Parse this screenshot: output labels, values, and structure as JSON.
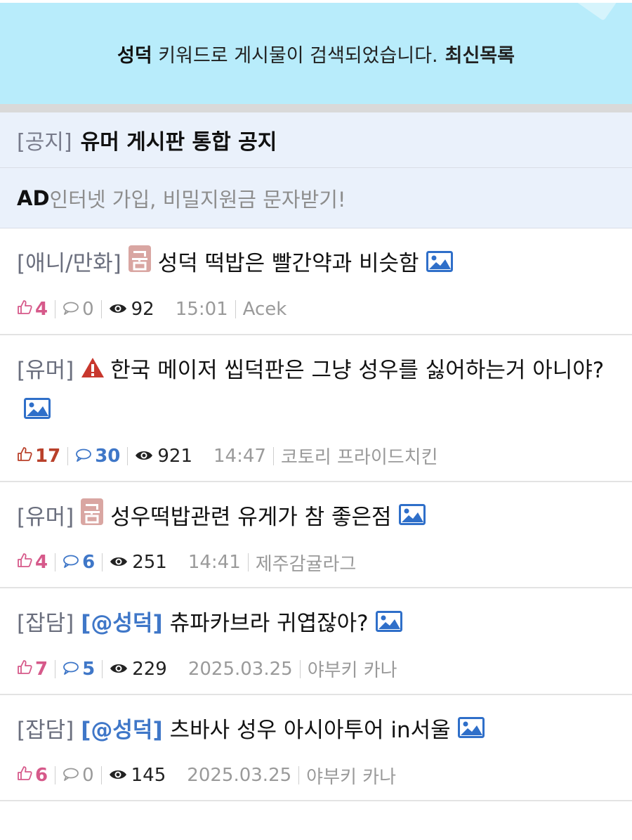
{
  "banner": {
    "keyword": "성덕",
    "message": " 키워드로 게시물이 검색되었습니다.",
    "latest_link": "최신목록"
  },
  "notice": {
    "tag": "[공지]",
    "title": "유머 게시판 통합 공지",
    "ad_label": "AD",
    "ad_text": "인터넷 가입, 비밀지원금 문자받기!"
  },
  "posts": [
    {
      "tag": "[애니/만화]",
      "badge": "곰",
      "mention": "",
      "title": "성덕 떡밥은 빨간약과 비슷함",
      "likes": "4",
      "comments": "0",
      "views": "92",
      "time": "15:01",
      "author": "Acek"
    },
    {
      "tag": "[유머]",
      "badge": "warning",
      "mention": "",
      "title": "한국 메이저 씹덕판은 그냥 성우를 싫어하는거 아니야?",
      "likes": "17",
      "comments": "30",
      "views": "921",
      "time": "14:47",
      "author": "코토리 프라이드치킨"
    },
    {
      "tag": "[유머]",
      "badge": "곰",
      "mention": "",
      "title": "성우떡밥관련 유게가 참 좋은점",
      "likes": "4",
      "comments": "6",
      "views": "251",
      "time": "14:41",
      "author": "제주감귤라그"
    },
    {
      "tag": "[잡담]",
      "badge": "",
      "mention": "[@성덕]",
      "title": "츄파카브라 귀엽잖아?",
      "likes": "7",
      "comments": "5",
      "views": "229",
      "time": "2025.03.25",
      "author": "야부키 카나"
    },
    {
      "tag": "[잡담]",
      "badge": "",
      "mention": "[@성덕]",
      "title": "츠바사 성우 아시아투어 in서울",
      "likes": "6",
      "comments": "0",
      "views": "145",
      "time": "2025.03.25",
      "author": "야부키 카나"
    }
  ],
  "colors": {
    "banner_bg": "#b8ecfb",
    "notice_bg": "#eaf1fb",
    "likes": "#d6598a",
    "likes_hot": "#b9402a",
    "comments_active": "#3f77c8",
    "mention": "#3f77c8",
    "image_icon": "#2f6fc9",
    "warning_icon": "#c8372d",
    "badge_bg": "#d9a6a2"
  },
  "icons": [
    "thumbs-up-icon",
    "comment-icon",
    "eye-icon",
    "image-icon",
    "warning-icon",
    "badge-icon"
  ]
}
